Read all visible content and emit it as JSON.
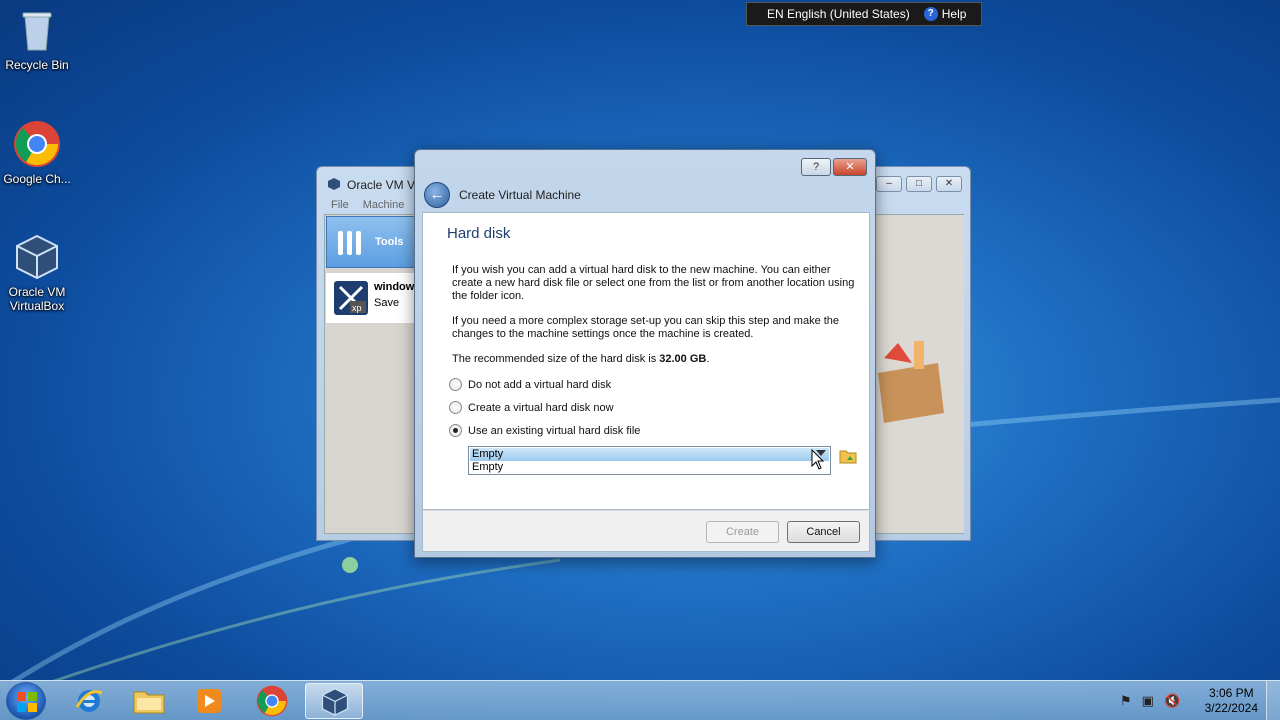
{
  "desktop": {
    "icons": [
      {
        "label": "Recycle Bin"
      },
      {
        "label": "Google Ch..."
      },
      {
        "label": "Oracle VM VirtualBox"
      }
    ]
  },
  "language_bar": {
    "language": "EN English (United States)",
    "help_label": "Help"
  },
  "background_window": {
    "title": "Oracle VM Vi",
    "menu": [
      "File",
      "Machine"
    ],
    "tools_label": "Tools",
    "vm_name": "window",
    "vm_state": "Save"
  },
  "dialog": {
    "title": "Create Virtual Machine",
    "page_title": "Hard disk",
    "para1": "If you wish you can add a virtual hard disk to the new machine. You can either create a new hard disk file or select one from the list or from another location using the folder icon.",
    "para2": "If you need a more complex storage set-up you can skip this step and make the changes to the machine settings once the machine is created.",
    "recommend_prefix": "The recommended size of the hard disk is ",
    "recommend_size": "32.00 GB",
    "recommend_suffix": ".",
    "options": [
      {
        "label": "Do not add a virtual hard disk",
        "checked": false
      },
      {
        "label": "Create a virtual hard disk now",
        "checked": false
      },
      {
        "label": "Use an existing virtual hard disk file",
        "checked": true
      }
    ],
    "combo": {
      "selected": "Empty",
      "items": [
        "Empty"
      ]
    },
    "buttons": {
      "help": "?",
      "close": "x",
      "create": "Create",
      "cancel": "Cancel"
    }
  },
  "taskbar": {
    "time": "3:06 PM",
    "date": "3/22/2024"
  },
  "colors": {
    "accent": "#1e3f6e",
    "selection": "#9bcbee"
  }
}
